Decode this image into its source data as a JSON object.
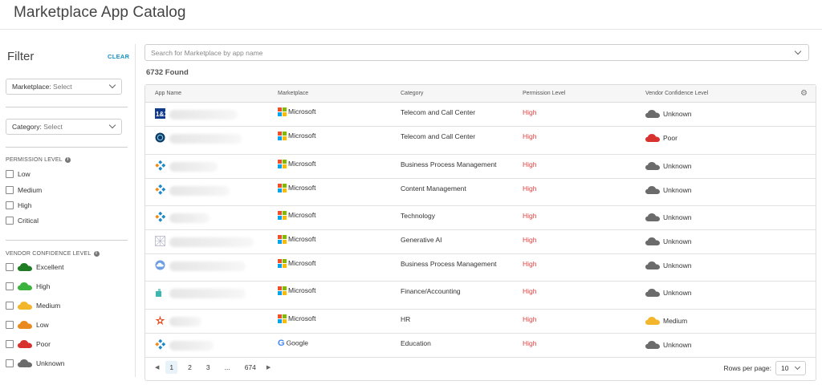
{
  "page_title": "Marketplace App Catalog",
  "filter": {
    "title": "Filter",
    "clear_label": "CLEAR",
    "marketplace": {
      "label": "Marketplace:",
      "value": "Select"
    },
    "category": {
      "label": "Category:",
      "value": "Select"
    },
    "permission_heading": "PERMISSION LEVEL",
    "permission_options": [
      "Low",
      "Medium",
      "High",
      "Critical"
    ],
    "vendor_heading": "VENDOR CONFIDENCE LEVEL",
    "vendor_options": [
      {
        "label": "Excellent",
        "color": "#1e7d22"
      },
      {
        "label": "High",
        "color": "#3db33f"
      },
      {
        "label": "Medium",
        "color": "#f3b62b"
      },
      {
        "label": "Low",
        "color": "#e98a1f"
      },
      {
        "label": "Poor",
        "color": "#d8322f"
      },
      {
        "label": "Unknown",
        "color": "#6b6b6b"
      }
    ]
  },
  "search": {
    "placeholder": "Search for Marketplace by app name"
  },
  "found_text": "6732 Found",
  "table": {
    "columns": [
      "App Name",
      "Marketplace",
      "Category",
      "Permission Level",
      "Vendor Confidence Level"
    ],
    "rows": [
      {
        "logo": "1and1-logo",
        "marketplace": "Microsoft",
        "category": "Telecom and Call Center",
        "permission": "High",
        "vendor": "Unknown",
        "vendor_color": "#6b6b6b"
      },
      {
        "logo": "globe-logo",
        "marketplace": "Microsoft",
        "category": "Telecom and Call Center",
        "permission": "High",
        "vendor": "Poor",
        "vendor_color": "#d8322f"
      },
      {
        "logo": "diamond-logo",
        "marketplace": "Microsoft",
        "category": "Business Process Management",
        "permission": "High",
        "vendor": "Unknown",
        "vendor_color": "#6b6b6b"
      },
      {
        "logo": "diamond-logo",
        "marketplace": "Microsoft",
        "category": "Content Management",
        "permission": "High",
        "vendor": "Unknown",
        "vendor_color": "#6b6b6b"
      },
      {
        "logo": "diamond-logo",
        "marketplace": "Microsoft",
        "category": "Technology",
        "permission": "High",
        "vendor": "Unknown",
        "vendor_color": "#6b6b6b"
      },
      {
        "logo": "grid-logo",
        "marketplace": "Microsoft",
        "category": "Generative AI",
        "permission": "High",
        "vendor": "Unknown",
        "vendor_color": "#6b6b6b"
      },
      {
        "logo": "cloud-logo",
        "marketplace": "Microsoft",
        "category": "Business Process Management",
        "permission": "High",
        "vendor": "Unknown",
        "vendor_color": "#6b6b6b"
      },
      {
        "logo": "teal-logo",
        "marketplace": "Microsoft",
        "category": "Finance/Accounting",
        "permission": "High",
        "vendor": "Unknown",
        "vendor_color": "#6b6b6b"
      },
      {
        "logo": "star-logo",
        "marketplace": "Microsoft",
        "category": "HR",
        "permission": "High",
        "vendor": "Medium",
        "vendor_color": "#f3b62b"
      },
      {
        "logo": "diamond-logo",
        "marketplace": "Google",
        "category": "Education",
        "permission": "High",
        "vendor": "Unknown",
        "vendor_color": "#6b6b6b"
      }
    ]
  },
  "pagination": {
    "pages": [
      "1",
      "2",
      "3",
      "...",
      "674"
    ],
    "rows_per_page_label": "Rows per page:",
    "rows_per_page_value": "10"
  }
}
